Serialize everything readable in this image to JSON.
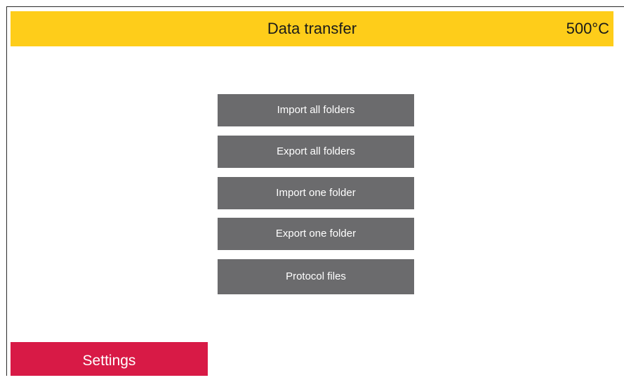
{
  "header": {
    "title": "Data transfer",
    "temperature": "500°C",
    "background_color": "#fecd1a"
  },
  "menu": {
    "button_color": "#6b6b6d",
    "items": [
      {
        "label": "Import all folders"
      },
      {
        "label": "Export all folders"
      },
      {
        "label": "Import one folder"
      },
      {
        "label": "Export one folder"
      },
      {
        "label": "Protocol files"
      }
    ]
  },
  "footer": {
    "settings_label": "Settings",
    "settings_color": "#d81a46"
  }
}
